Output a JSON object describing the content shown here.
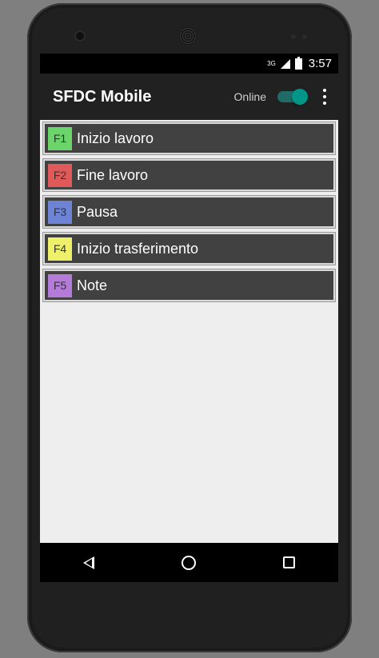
{
  "status_bar": {
    "network": "3G",
    "time": "3:57"
  },
  "app_bar": {
    "title": "SFDC Mobile",
    "online_label": "Online",
    "online_toggle_on": true,
    "switch_color": "#009688"
  },
  "list": {
    "items": [
      {
        "key": "F1",
        "label": "Inizio lavoro",
        "color": "#6bd46b"
      },
      {
        "key": "F2",
        "label": "Fine lavoro",
        "color": "#e05a5a"
      },
      {
        "key": "F3",
        "label": "Pausa",
        "color": "#6d83d6"
      },
      {
        "key": "F4",
        "label": "Inizio trasferimento",
        "color": "#eef06a"
      },
      {
        "key": "F5",
        "label": "Note",
        "color": "#b57bd9"
      }
    ]
  },
  "nav_bar": {
    "icons": [
      "back-icon",
      "home-icon",
      "recents-icon"
    ]
  }
}
